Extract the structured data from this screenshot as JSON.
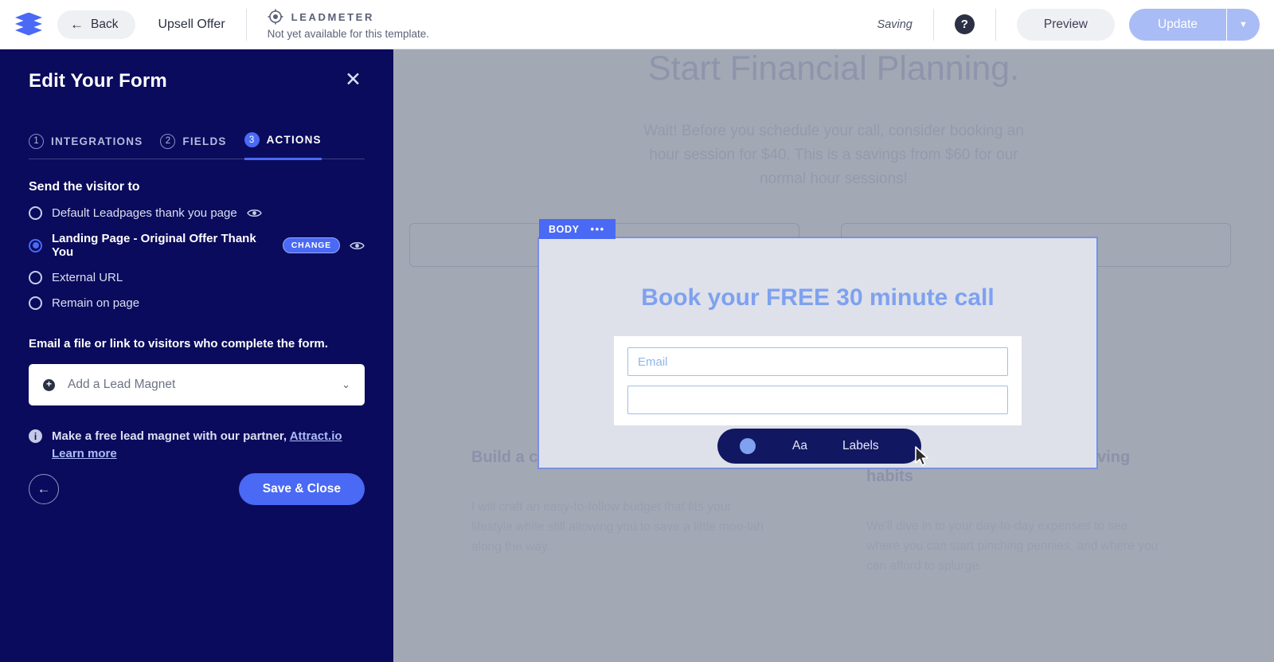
{
  "topbar": {
    "logo_icon": "leadpages-stack-icon",
    "back_label": "Back",
    "back_arrow_icon": "arrow-left-icon",
    "doc_title": "Upsell Offer",
    "leadmeter": {
      "icon": "target-icon",
      "label": "LEADMETER",
      "sub": "Not yet available for this template."
    },
    "saving_status": "Saving",
    "help_icon": "question-mark-icon",
    "help_label": "?",
    "preview_label": "Preview",
    "update_label": "Update",
    "update_caret_icon": "chevron-down-icon",
    "update_caret_glyph": "▼"
  },
  "sidebar": {
    "title": "Edit Your Form",
    "close_icon": "close-icon",
    "close_glyph": "✕",
    "steps": [
      {
        "num": "1",
        "label": "INTEGRATIONS",
        "active": false
      },
      {
        "num": "2",
        "label": "FIELDS",
        "active": false
      },
      {
        "num": "3",
        "label": "ACTIONS",
        "active": true
      }
    ],
    "send_visitor_label": "Send the visitor to",
    "options": [
      {
        "label": "Default Leadpages thank you page",
        "selected": false,
        "eye": true,
        "change": false
      },
      {
        "label": "Landing Page - Original Offer Thank You",
        "selected": true,
        "eye": true,
        "change": true
      },
      {
        "label": "External URL",
        "selected": false,
        "eye": false,
        "change": false
      },
      {
        "label": "Remain on page",
        "selected": false,
        "eye": false,
        "change": false
      }
    ],
    "change_badge_label": "CHANGE",
    "eye_icon": "eye-icon",
    "email_note": "Email a file or link to visitors who complete the form.",
    "lead_magnet": {
      "plus_icon": "plus-circle-icon",
      "plus_glyph": "+",
      "placeholder": "Add a Lead Magnet",
      "caret_icon": "chevron-down-icon",
      "caret_glyph": "⌄"
    },
    "partner_note": {
      "info_icon": "info-icon",
      "info_glyph": "i",
      "text_before": "Make a free lead magnet with our partner, ",
      "link_1": "Attract.io",
      "link_2": "Learn more"
    },
    "footer": {
      "back_circle_icon": "arrow-left-circle-icon",
      "back_circle_glyph": "←",
      "save_close_label": "Save & Close"
    },
    "colors": {
      "panel_bg": "#0A0B5C",
      "accent": "#4A69F4"
    }
  },
  "canvas": {
    "headline": "Start Financial Planning.",
    "subtext": "Wait! Before you schedule your call, consider booking an hour session for $40. This is a savings from $60 for our normal hour sessions!",
    "columns": [
      {
        "heading": "Build a custom budget that fits you",
        "body": "I will craft an easy-to-follow budget that fits your lifestyle while still allowing you to save a little moo-lah along the way."
      },
      {
        "heading": "Improve your spending and saving habits",
        "body": "We'll dive in to your day-to-day expenses to see where you can start pinching pennies, and where you can afford to splurge."
      }
    ],
    "body_block": {
      "tag_label": "BODY",
      "tag_dots_icon": "ellipsis-icon",
      "tag_dots_glyph": "•••",
      "form_title": "Book your FREE 30 minute call",
      "email_placeholder": "Email",
      "toolbar": {
        "toggle_icon": "toggle-knob-icon",
        "font_label": "Aa",
        "labels_label": "Labels"
      }
    },
    "colors": {
      "canvas_bg": "#A3A8B5",
      "block_bg": "#DEE1EA",
      "heading_blue": "#7EA1F0"
    },
    "cursor_icon": "mouse-pointer-icon"
  }
}
